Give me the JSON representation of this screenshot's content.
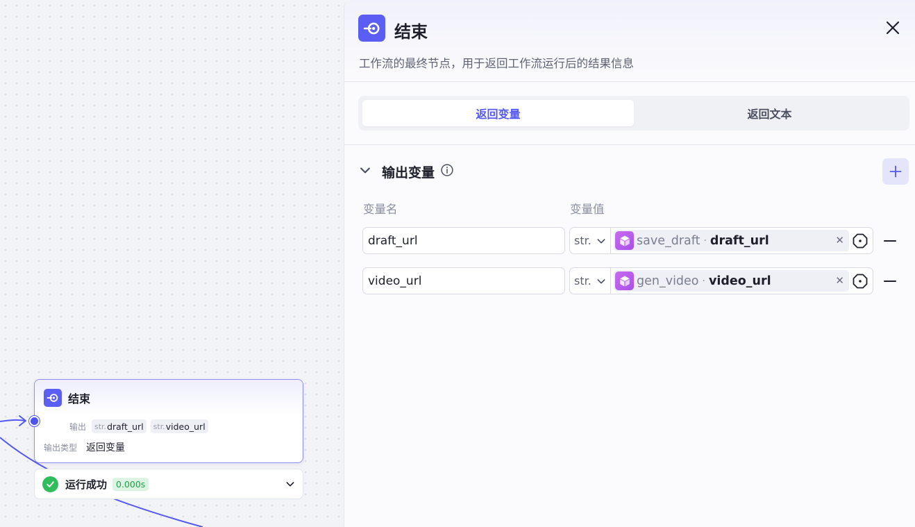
{
  "canvas": {
    "node": {
      "title": "结束",
      "output_label": "输出",
      "output_tags": [
        {
          "type": "str.",
          "name": "draft_url"
        },
        {
          "type": "str.",
          "name": "video_url"
        }
      ],
      "output_type_label": "输出类型",
      "output_type_value": "返回变量"
    },
    "run_status": {
      "text": "运行成功",
      "time": "0.000s"
    },
    "colors": {
      "accent": "#5b5ef2",
      "success": "#2fbd5b"
    }
  },
  "panel": {
    "title": "结束",
    "description": "工作流的最终节点，用于返回工作流运行后的结果信息",
    "tabs": [
      {
        "label": "返回变量",
        "active": true
      },
      {
        "label": "返回文本",
        "active": false
      }
    ],
    "section": {
      "title": "输出变量",
      "col_name": "变量名",
      "col_value": "变量值"
    },
    "variables": [
      {
        "name": "draft_url",
        "type": "str.",
        "ref_node": "save_draft",
        "sep": "·",
        "ref_var": "draft_url"
      },
      {
        "name": "video_url",
        "type": "str.",
        "ref_node": "gen_video",
        "sep": "·",
        "ref_var": "video_url"
      }
    ],
    "icons": {
      "header": "end-node-icon",
      "close": "close-icon",
      "collapse": "chevron-down-icon",
      "info": "info-icon",
      "add": "plus-icon",
      "ref": "cube-icon",
      "target": "target-icon",
      "remove": "minus-icon"
    }
  }
}
